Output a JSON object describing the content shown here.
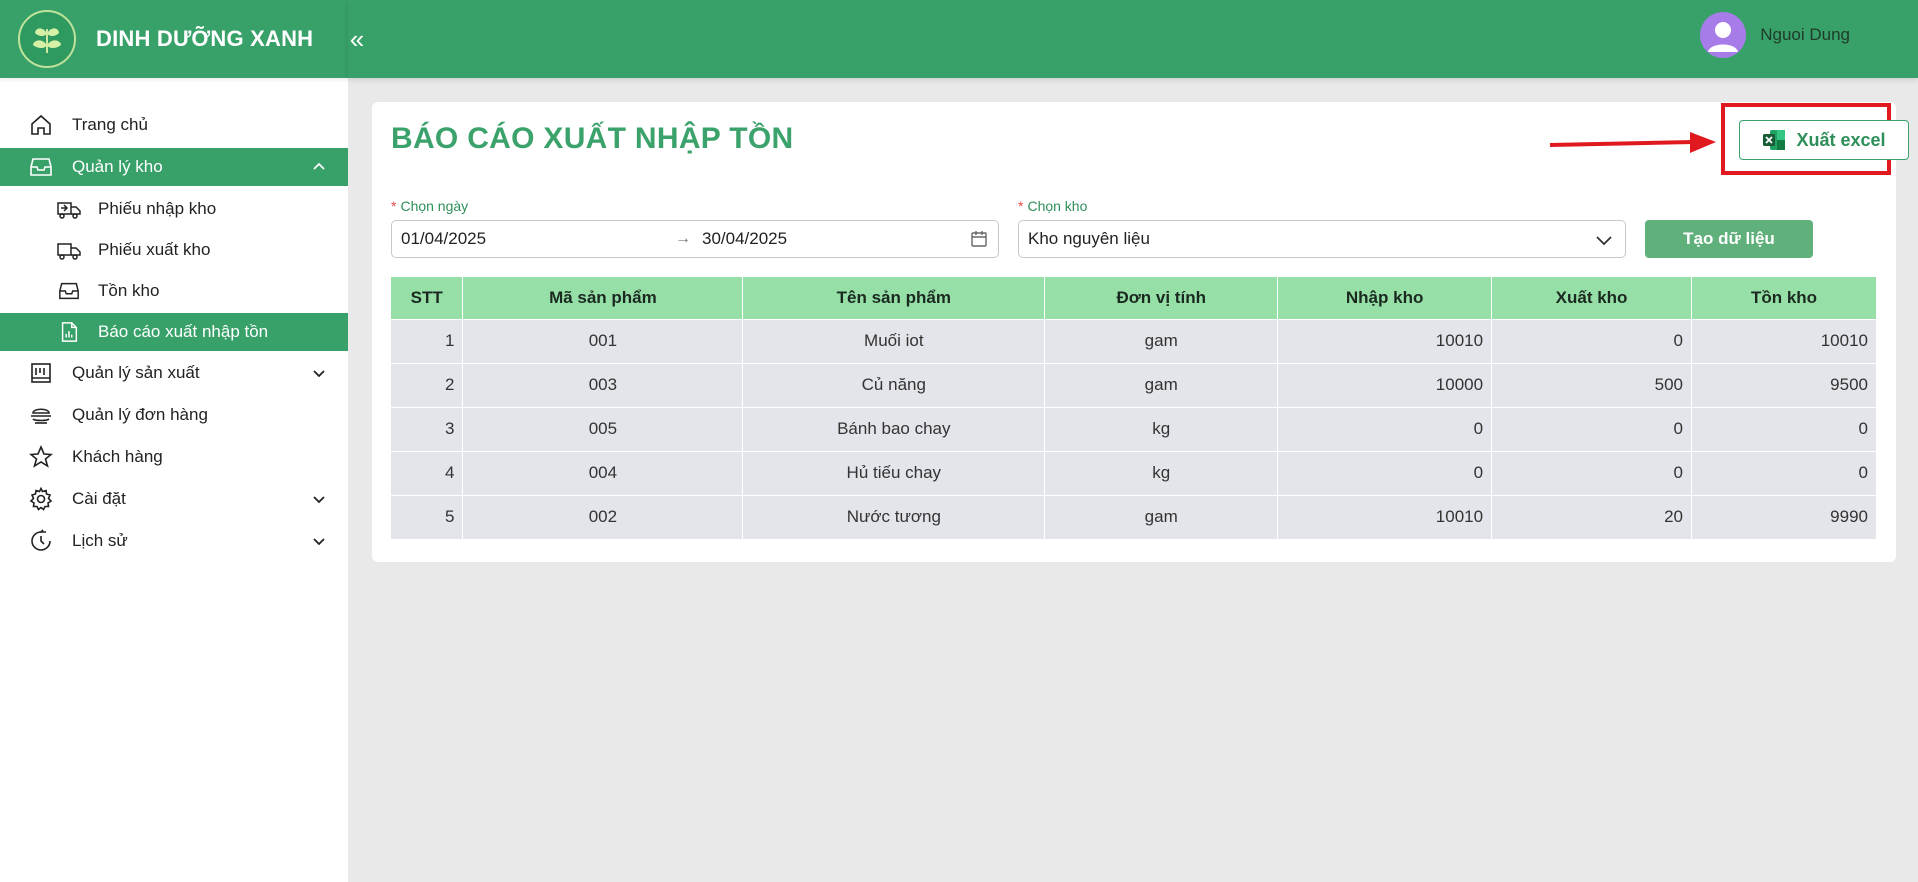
{
  "brand": {
    "name": "DINH DƯỠNG XANH"
  },
  "header": {
    "collapse_glyph": "«",
    "user_name": "Nguoi Dung"
  },
  "sidebar": {
    "items": [
      {
        "label": "Trang chủ",
        "icon": "home-icon"
      },
      {
        "label": "Quản lý kho",
        "icon": "inbox-icon",
        "expanded": true,
        "children": [
          {
            "label": "Phiếu nhập kho",
            "icon": "truck-in-icon"
          },
          {
            "label": "Phiếu xuất kho",
            "icon": "truck-out-icon"
          },
          {
            "label": "Tồn kho",
            "icon": "box-icon"
          },
          {
            "label": "Báo cáo xuất nhập tồn",
            "icon": "report-icon",
            "active": true
          }
        ]
      },
      {
        "label": "Quản lý sản xuất",
        "icon": "factory-icon"
      },
      {
        "label": "Quản lý đơn hàng",
        "icon": "order-icon"
      },
      {
        "label": "Khách hàng",
        "icon": "star-icon"
      },
      {
        "label": "Cài đặt",
        "icon": "gear-icon"
      },
      {
        "label": "Lịch sử",
        "icon": "clock-icon"
      }
    ]
  },
  "page": {
    "title": "BÁO CÁO XUẤT NHẬP TỒN",
    "export_label": "Xuất excel",
    "date_label": "Chọn ngày",
    "date_from": "01/04/2025",
    "date_sep": "→",
    "date_to": "30/04/2025",
    "warehouse_label": "Chọn kho",
    "warehouse_value": "Kho nguyên liệu",
    "generate_label": "Tạo dữ liệu"
  },
  "table": {
    "headers": [
      "STT",
      "Mã sản phẩm",
      "Tên sản phẩm",
      "Đơn vị tính",
      "Nhập kho",
      "Xuất kho",
      "Tồn kho"
    ],
    "rows": [
      [
        "1",
        "001",
        "Muối iot",
        "gam",
        "10010",
        "0",
        "10010"
      ],
      [
        "2",
        "003",
        "Củ năng",
        "gam",
        "10000",
        "500",
        "9500"
      ],
      [
        "3",
        "005",
        "Bánh bao chay",
        "kg",
        "0",
        "0",
        "0"
      ],
      [
        "4",
        "004",
        "Hủ tiếu chay",
        "kg",
        "0",
        "0",
        "0"
      ],
      [
        "5",
        "002",
        "Nước tương",
        "gam",
        "10010",
        "20",
        "9990"
      ]
    ]
  },
  "colors": {
    "primary": "#38a169",
    "header_row": "#96e0a8",
    "highlight": "#e0191f"
  }
}
